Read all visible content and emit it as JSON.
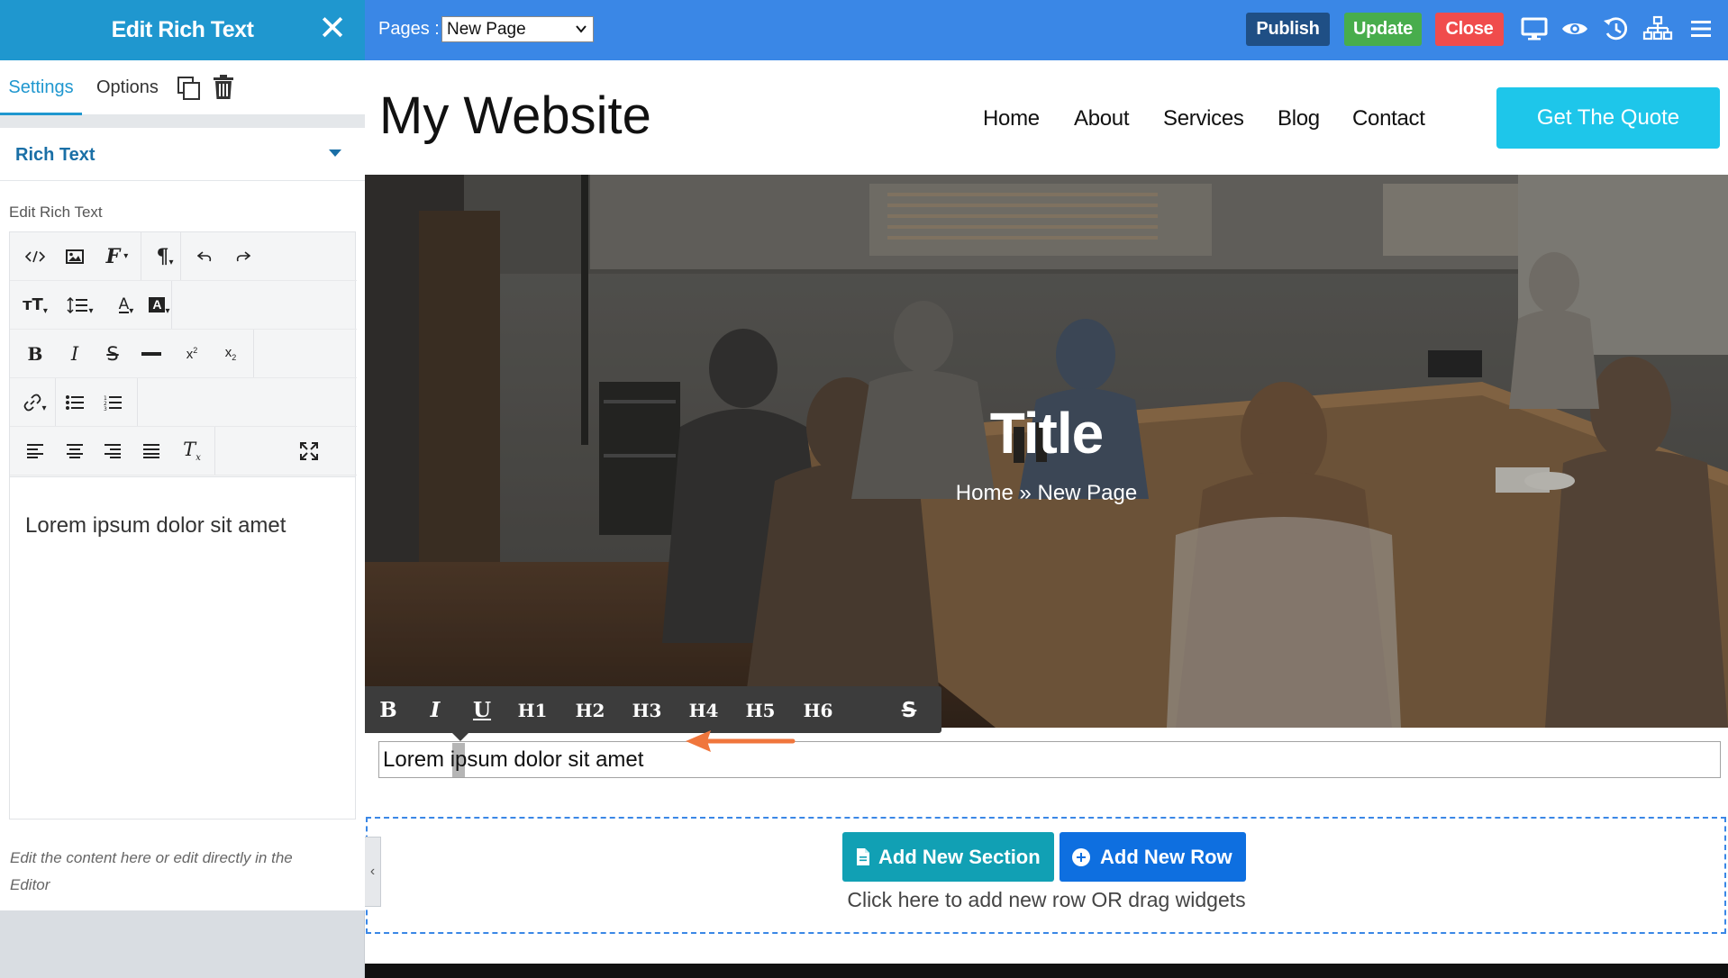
{
  "panel": {
    "title": "Edit Rich Text",
    "tabs": [
      "Settings",
      "Options"
    ],
    "section_label": "Rich Text",
    "editor_label": "Edit Rich Text",
    "editor_content": "Lorem ipsum dolor sit amet",
    "hint": "Edit the content here or edit directly in the Editor",
    "toolbar_rows": [
      [
        "code-view",
        "insert-image",
        "font-family",
        "paragraph-format",
        "undo",
        "redo"
      ],
      [
        "font-size",
        "line-height",
        "text-color",
        "background-color"
      ],
      [
        "bold",
        "italic",
        "strikethrough",
        "horizontal-line",
        "superscript",
        "subscript"
      ],
      [
        "insert-link",
        "unordered-list",
        "ordered-list"
      ],
      [
        "align-left",
        "align-center",
        "align-right",
        "align-justify",
        "clear-formatting",
        "fullscreen"
      ]
    ]
  },
  "topbar": {
    "pages_label": "Pages :",
    "pages_selected": "New Page",
    "publish": "Publish",
    "update": "Update",
    "close": "Close",
    "colors": {
      "bar": "#3a87e6",
      "publish": "#1f4f85",
      "update": "#48ad4c",
      "close": "#f04c4c"
    }
  },
  "site": {
    "logo": "My Website",
    "nav": [
      "Home",
      "About",
      "Services",
      "Blog",
      "Contact"
    ],
    "cta": "Get The Quote",
    "hero_title": "Title",
    "hero_breadcrumb": "Home » New Page",
    "inline_toolbar": [
      "B",
      "I",
      "U",
      "H1",
      "H2",
      "H3",
      "H4",
      "H5",
      "H6",
      "S"
    ],
    "text_block": "Lorem ipsum dolor sit amet",
    "add_section": "Add New Section",
    "add_row": "Add New Row",
    "drop_hint": "Click here to add new row OR drag widgets",
    "collapse_glyph": "‹"
  }
}
